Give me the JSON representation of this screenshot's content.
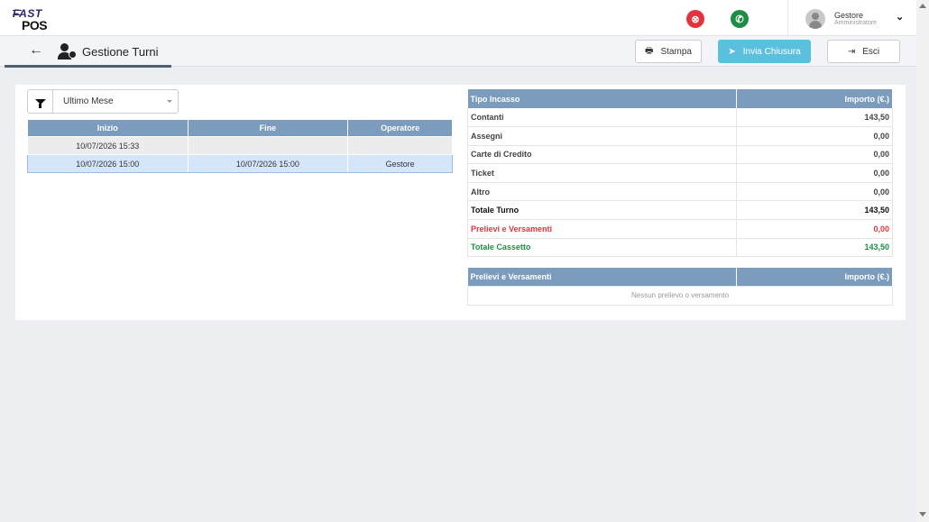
{
  "app": {
    "logo_line1": "FAST",
    "logo_line2": "POS"
  },
  "header": {
    "user_name": "Gestore",
    "user_role": "Amministratore",
    "close_icon": "circle-x-icon",
    "whatsapp_icon": "whatsapp-icon"
  },
  "page": {
    "title": "Gestione Turni"
  },
  "toolbar": {
    "print_label": "Stampa",
    "send_label": "Invia Chiusura",
    "exit_label": "Esci"
  },
  "filter": {
    "value": "Ultimo Mese"
  },
  "shifts": {
    "headers": [
      "Inizio",
      "Fine",
      "Operatore"
    ],
    "rows": [
      {
        "start": "10/07/2026 15:33",
        "end": "",
        "operator": ""
      },
      {
        "start": "10/07/2026 15:00",
        "end": "10/07/2026 15:00",
        "operator": "Gestore"
      }
    ]
  },
  "income": {
    "header_type": "Tipo Incasso",
    "header_amount": "Importo (€.)",
    "rows": [
      {
        "label": "Contanti",
        "amount": "143,50"
      },
      {
        "label": "Assegni",
        "amount": "0,00"
      },
      {
        "label": "Carte di Credito",
        "amount": "0,00"
      },
      {
        "label": "Ticket",
        "amount": "0,00"
      },
      {
        "label": "Altro",
        "amount": "0,00"
      },
      {
        "label": "Totale Turno",
        "amount": "143,50"
      },
      {
        "label": "Prelievi e Versamenti",
        "amount": "0,00"
      },
      {
        "label": "Totale Cassetto",
        "amount": "143,50"
      }
    ]
  },
  "withdrawals": {
    "header_type": "Prelievi e Versamenti",
    "header_amount": "Importo (€.)",
    "empty_text": "Nessun prelievo o versamento"
  },
  "colors": {
    "table_header": "#7b9cbd",
    "accent_button": "#5bc0de",
    "danger": "#e0343f",
    "success": "#1e8e45",
    "selected_row": "#d5e6fb"
  }
}
